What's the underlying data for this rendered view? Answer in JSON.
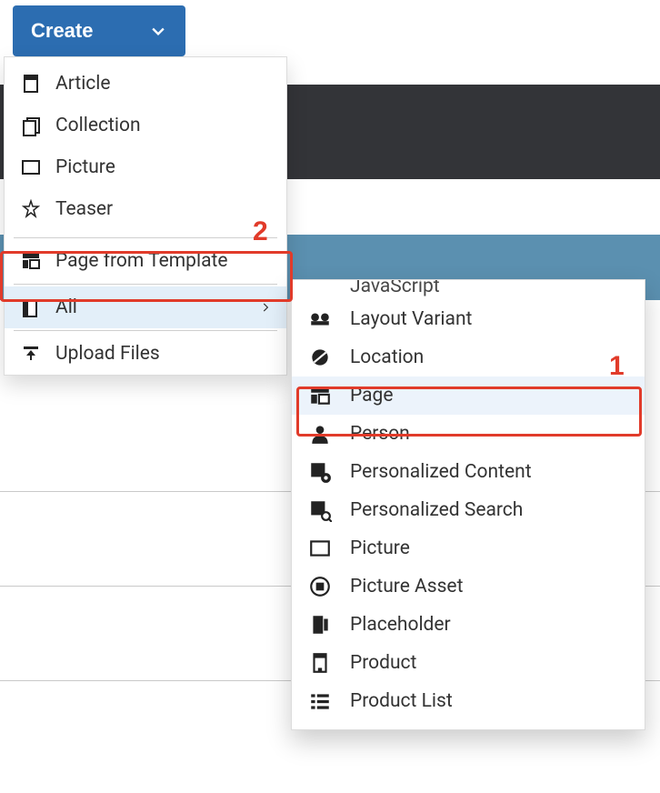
{
  "create_button": {
    "label": "Create"
  },
  "menu": {
    "items": [
      {
        "label": "Article",
        "icon": "article-icon"
      },
      {
        "label": "Collection",
        "icon": "collection-icon"
      },
      {
        "label": "Picture",
        "icon": "picture-icon"
      },
      {
        "label": "Teaser",
        "icon": "teaser-icon"
      }
    ],
    "page_from_template": {
      "label": "Page from Template",
      "icon": "page-template-icon"
    },
    "all": {
      "label": "All",
      "icon": "all-icon"
    },
    "upload": {
      "label": "Upload Files",
      "icon": "upload-icon"
    }
  },
  "submenu": {
    "partial_top": {
      "label": "JavaScript",
      "icon": "javascript-icon"
    },
    "items": [
      {
        "label": "Layout Variant",
        "icon": "layout-variant-icon"
      },
      {
        "label": "Location",
        "icon": "location-icon"
      },
      {
        "label": "Page",
        "icon": "page-icon",
        "active": true
      },
      {
        "label": "Person",
        "icon": "person-icon"
      },
      {
        "label": "Personalized Content",
        "icon": "personalized-content-icon"
      },
      {
        "label": "Personalized Search",
        "icon": "personalized-search-icon"
      },
      {
        "label": "Picture",
        "icon": "picture-icon"
      },
      {
        "label": "Picture Asset",
        "icon": "picture-asset-icon"
      },
      {
        "label": "Placeholder",
        "icon": "placeholder-icon"
      },
      {
        "label": "Product",
        "icon": "product-icon"
      },
      {
        "label": "Product List",
        "icon": "product-list-icon"
      }
    ]
  },
  "annotations": {
    "one": "1",
    "two": "2"
  },
  "colors": {
    "primary": "#2c6db1",
    "highlight": "#e13b2a",
    "menu_active_bg": "#e3eff9"
  }
}
